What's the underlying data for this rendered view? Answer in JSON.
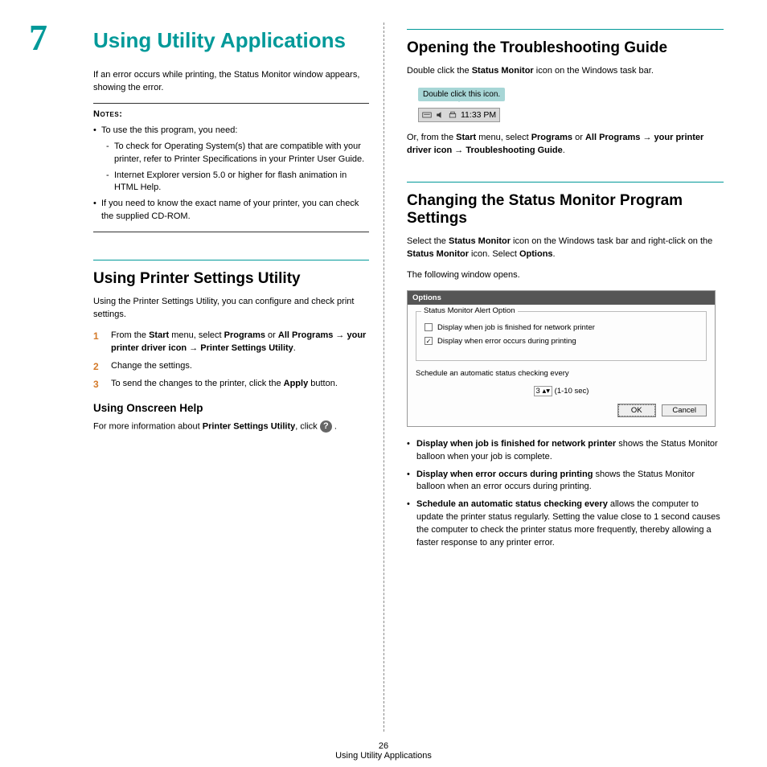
{
  "chapter": {
    "number": "7",
    "title": "Using Utility Applications"
  },
  "left": {
    "intro": "If an error occurs while printing, the Status Monitor window appears, showing the error.",
    "notes_label": "Notes",
    "note1": "To use the this program, you need:",
    "note1a": "To check for Operating System(s) that are compatible with your printer, refer to Printer Specifications in your Printer User Guide.",
    "note1b": "Internet Explorer version 5.0 or higher for flash animation in HTML Help.",
    "note2": "If you need to know the exact name of your printer, you can check the supplied CD-ROM.",
    "h2a": "Using Printer Settings Utility",
    "p2": "Using the Printer Settings Utility, you can configure and check print settings.",
    "s1_a": "From the ",
    "s1_b": "Start",
    "s1_c": " menu, select ",
    "s1_d": "Programs",
    "s1_e": " or ",
    "s1_f": "All Programs",
    "s1_g": " → ",
    "s1_h": "your printer driver icon",
    "s1_i": " → ",
    "s1_j": "Printer Settings Utility",
    "s1_k": ".",
    "s2": "Change the settings.",
    "s3_a": "To send the changes to the printer, click the ",
    "s3_b": "Apply",
    "s3_c": " button.",
    "h3": "Using Onscreen Help",
    "help_a": "For more information about ",
    "help_b": "Printer Settings Utility",
    "help_c": ", click ",
    "help_d": "."
  },
  "right": {
    "h2a": "Opening the Troubleshooting Guide",
    "p1_a": "Double click the ",
    "p1_b": "Status Monitor",
    "p1_c": " icon on the Windows task bar.",
    "callout": "Double click this icon.",
    "tray_time": "11:33 PM",
    "p2_a": "Or, from the ",
    "p2_b": "Start",
    "p2_c": " menu, select ",
    "p2_d": "Programs",
    "p2_e": " or ",
    "p2_f": "All Programs",
    "p2_g": " → ",
    "p2_h": "your printer driver icon",
    "p2_i": " → ",
    "p2_j": "Troubleshooting Guide",
    "p2_k": ".",
    "h2b": "Changing the Status Monitor Program Settings",
    "p3_a": "Select the ",
    "p3_b": "Status Monitor",
    "p3_c": " icon on the Windows task bar and right-click on the ",
    "p3_d": "Status Monitor",
    "p3_e": " icon. Select ",
    "p3_f": "Options",
    "p3_g": ".",
    "p4": "The following window opens.",
    "win": {
      "title": "Options",
      "legend": "Status Monitor Alert Option",
      "chk1": "Display when job is finished for network printer",
      "chk2": "Display when error occurs during printing",
      "sched": "Schedule an automatic status checking every",
      "spin": "3",
      "unit": "(1-10 sec)",
      "ok": "OK",
      "cancel": "Cancel"
    },
    "b1_a": "Display when job is finished for network printer",
    "b1_b": " shows the Status Monitor balloon when your job is complete.",
    "b2_a": "Display when error occurs during printing",
    "b2_b": " shows the Status Monitor balloon when an error occurs during printing.",
    "b3_a": "Schedule an automatic status checking every",
    "b3_b": " allows the computer to update the printer status regularly. Setting the value close to 1 second causes the computer to check the printer status more frequently, thereby allowing a faster response to any printer error."
  },
  "footer": {
    "pagenum": "26",
    "title": "Using Utility Applications"
  }
}
